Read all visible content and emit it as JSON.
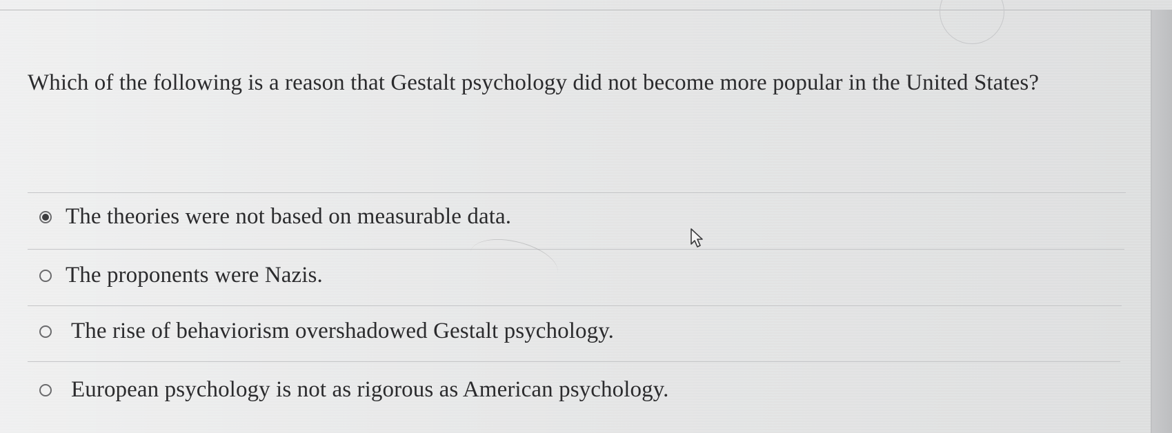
{
  "question": {
    "text": "Which of the following is a reason that Gestalt psychology did not become more popular in the United States?"
  },
  "options": [
    {
      "label": "The theories were not based on measurable data.",
      "selected": true
    },
    {
      "label": "The proponents were Nazis.",
      "selected": false
    },
    {
      "label": "The rise of behaviorism overshadowed Gestalt psychology.",
      "selected": false
    },
    {
      "label": "European psychology is not as rigorous as American psychology.",
      "selected": false
    }
  ],
  "icons": {
    "cursor": "mouse-pointer-icon",
    "radio": "radio-button-icon"
  },
  "colors": {
    "text": "#2b2b2d",
    "background": "#dedfe0",
    "separator": "#c4c5c7"
  }
}
